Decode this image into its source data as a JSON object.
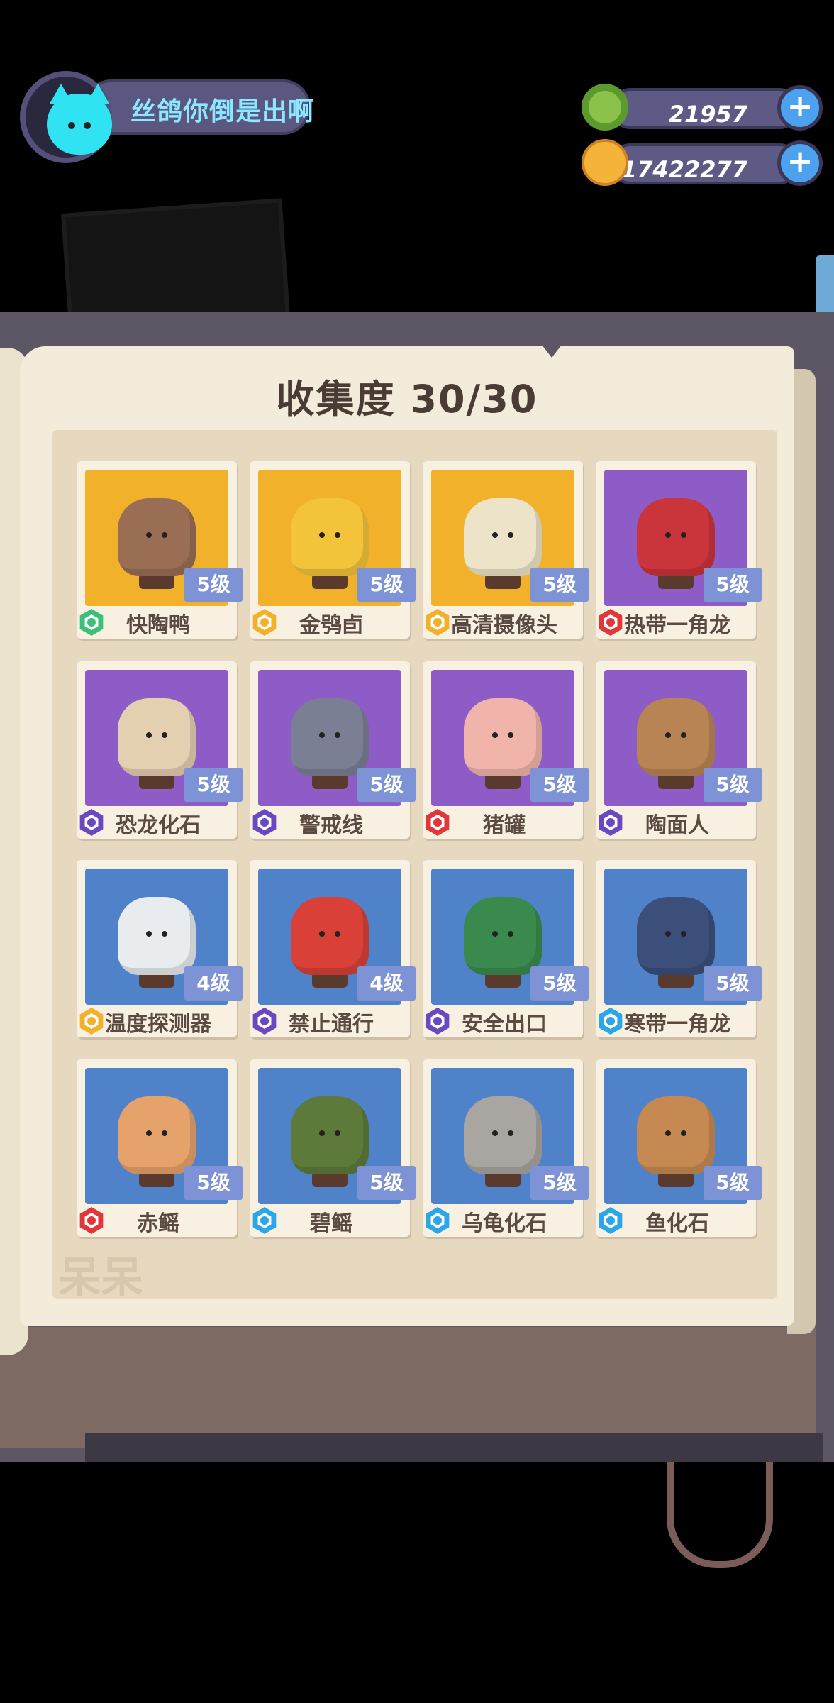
{
  "player": {
    "name": "丝鸽你倒是出啊",
    "avatar_icon": "cat-avatar-icon"
  },
  "currencies": [
    {
      "icon": "green-donut-coin-icon",
      "value": "21957",
      "color": "#7bbf4a"
    },
    {
      "icon": "gold-planet-coin-icon",
      "value": "117422277",
      "color": "#f0a52a"
    }
  ],
  "collection": {
    "title": "收集度 30/30",
    "items": [
      {
        "name": "快陶鸭",
        "level": "5级",
        "element": "green",
        "bg": "#f2b12b",
        "body": "#9a6e55"
      },
      {
        "name": "金鸮卣",
        "level": "5级",
        "element": "gold",
        "bg": "#f2b12b",
        "body": "#f3c43a"
      },
      {
        "name": "高清摄像头",
        "level": "5级",
        "element": "gold",
        "bg": "#f2b12b",
        "body": "#ede3c8"
      },
      {
        "name": "热带一角龙",
        "level": "5级",
        "element": "red",
        "bg": "#8e5cc6",
        "body": "#c9353a"
      },
      {
        "name": "恐龙化石",
        "level": "5级",
        "element": "purple",
        "bg": "#8e5cc6",
        "body": "#e5cfb1"
      },
      {
        "name": "警戒线",
        "level": "5级",
        "element": "purple",
        "bg": "#8e5cc6",
        "body": "#7b7f93"
      },
      {
        "name": "猪罐",
        "level": "5级",
        "element": "red",
        "bg": "#8e5cc6",
        "body": "#f1b4aa"
      },
      {
        "name": "陶面人",
        "level": "5级",
        "element": "purple",
        "bg": "#8e5cc6",
        "body": "#b98453"
      },
      {
        "name": "温度探测器",
        "level": "4级",
        "element": "gold",
        "bg": "#4f82c9",
        "body": "#e8ecef"
      },
      {
        "name": "禁止通行",
        "level": "4级",
        "element": "purple",
        "bg": "#4f82c9",
        "body": "#d84038"
      },
      {
        "name": "安全出口",
        "level": "5级",
        "element": "purple",
        "bg": "#4f82c9",
        "body": "#3a8a4d"
      },
      {
        "name": "寒带一角龙",
        "level": "5级",
        "element": "blue",
        "bg": "#4f82c9",
        "body": "#3c4f7a"
      },
      {
        "name": "赤鳐",
        "level": "5级",
        "element": "red",
        "bg": "#4f82c9",
        "body": "#e6a26b"
      },
      {
        "name": "碧鳐",
        "level": "5级",
        "element": "blue",
        "bg": "#4f82c9",
        "body": "#5d7a3a"
      },
      {
        "name": "乌龟化石",
        "level": "5级",
        "element": "blue",
        "bg": "#4f82c9",
        "body": "#a9a5a1"
      },
      {
        "name": "鱼化石",
        "level": "5级",
        "element": "blue",
        "bg": "#4f82c9",
        "body": "#c78952"
      }
    ]
  },
  "element_colors": {
    "green": "#3cbf78",
    "gold": "#f2b12b",
    "red": "#e0373a",
    "purple": "#6a48c2",
    "blue": "#2ba6e6"
  },
  "watermark": "呆呆"
}
